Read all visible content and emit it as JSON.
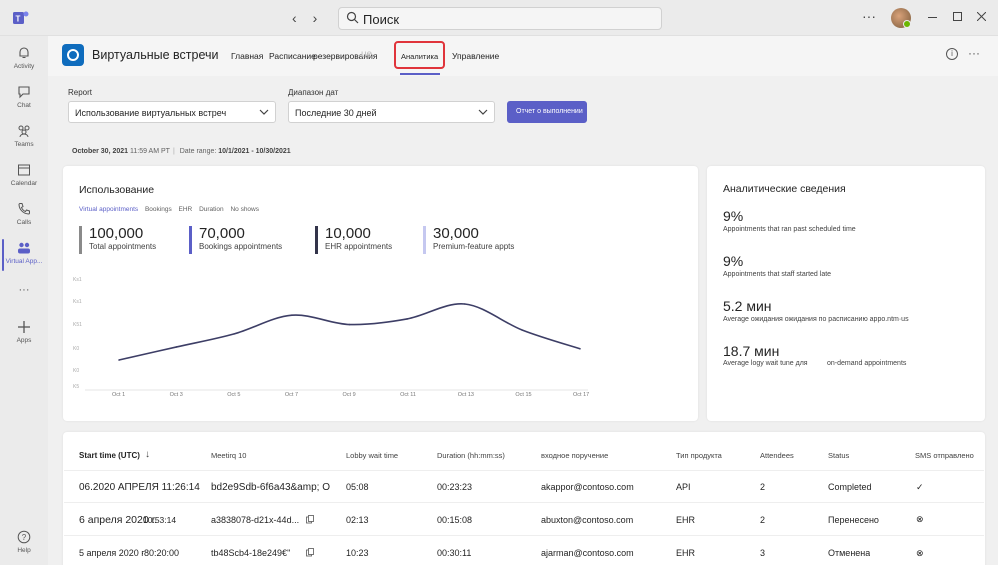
{
  "topbar": {
    "search_placeholder": "Поиск",
    "back": "‹",
    "forward": "›",
    "more": "···"
  },
  "rail": [
    {
      "label": "Activity",
      "icon": "bell-icon"
    },
    {
      "label": "Chat",
      "icon": "chat-icon"
    },
    {
      "label": "Teams",
      "icon": "teams-icon"
    },
    {
      "label": "Calendar",
      "icon": "calendar-icon"
    },
    {
      "label": "Calls",
      "icon": "phone-icon"
    },
    {
      "label": "Virtual App...",
      "icon": "virtual-appointments-icon"
    },
    {
      "label": "···",
      "icon": "more-icon"
    },
    {
      "label": "Apps",
      "icon": "plus-icon"
    },
    {
      "label": "Help",
      "icon": "help-icon"
    }
  ],
  "app": {
    "title": "Виртуальные встречи",
    "tabs": {
      "home": "Главная",
      "schedule": "Расписание",
      "reserved": "резервирования",
      "ghost": "ue",
      "analytics": "Аналитика",
      "manage": "Управление"
    }
  },
  "filters": {
    "report_label": "Report",
    "report_value": "Использование виртуальных встреч",
    "range_label": "Диапазон дат",
    "range_value": "Последние 30 дней",
    "run_button": "Отчет о выполнении"
  },
  "meta": {
    "date": "October 30, 2021",
    "time": "11:59 AM PT",
    "range_label": "Date range:",
    "range": "10/1/2021 - 10/30/2021"
  },
  "usage": {
    "title": "Использование",
    "chips": [
      "Virtual appointments",
      "Bookings",
      "EHR",
      "Duration",
      "No shows"
    ],
    "kpis": [
      {
        "value": "100,000",
        "label": "Total appointments",
        "color": "#8a8a8a"
      },
      {
        "value": "70,000",
        "label": "Bookings appointments",
        "color": "#5b5fc7"
      },
      {
        "value": "10,000",
        "label": "EHR appointments",
        "color": "#33344a"
      },
      {
        "value": "30,000",
        "label": "Premium-feature appts",
        "color": "#c5c8f0"
      }
    ],
    "y_ticks": [
      "Ks1",
      "Ks1",
      "K51",
      "K0",
      "K0",
      "K5"
    ]
  },
  "chart_data": {
    "type": "line",
    "x": [
      "Oct 1",
      "Oct 3",
      "Oct 5",
      "Oct 7",
      "Oct 9",
      "Oct 11",
      "Oct 13",
      "Oct 15",
      "Oct 17"
    ],
    "series": [
      {
        "values": [
          1.5,
          2.2,
          2.9,
          3.9,
          3.4,
          3.7,
          4.5,
          3.1,
          2.1
        ]
      }
    ],
    "ylim": [
      0,
      6
    ],
    "grid": false,
    "line_color": "#3d3e66"
  },
  "insights": {
    "title": "Аналитические сведения",
    "items": [
      {
        "value": "9%",
        "label": "Appointments that ran past scheduled time"
      },
      {
        "value": "9%",
        "label": "Appointments that staff started late"
      },
      {
        "value": "5.2 мин",
        "label": "Average ожидания ожидания по расписанию appo.ntm·us"
      },
      {
        "value": "18.7 мин",
        "label": "Average logy wait tune для",
        "label2": "on-demand appointments"
      }
    ]
  },
  "table": {
    "headers": [
      "Start time (UTC)",
      "Meetirq 10",
      "Lobby wait time",
      "Duration (hh:mm:ss)",
      "входное поручение",
      "Тип продукта",
      "Attendees",
      "Status",
      "SMS отправлено"
    ],
    "sort_arrow": "↓",
    "rows": [
      {
        "start": "06.2020 АПРЕЛЯ 11:26:14",
        "id": "bd2e9Sdb-6f6a43&amp; O",
        "lobby": "05:08",
        "duration": "00:23:23",
        "email": "akappor@contoso.com",
        "product": "API",
        "attendees": "2",
        "status": "Completed",
        "sms": "✓"
      },
      {
        "start": "6 апреля 2020 г.",
        "start_overlay": "10:53:14",
        "id": "a3838078-d21x-44d...",
        "lobby": "02:13",
        "duration": "00:15:08",
        "email": "abuxton@contoso.com",
        "product": "EHR",
        "attendees": "2",
        "status": "Перенесено",
        "sms": "⊗"
      },
      {
        "start": "5 апреля 2020 г",
        "start_overlay": "·80:20:00",
        "id": "tb48Scb4-18e249€\"",
        "lobby": "10:23",
        "duration": "00:30:11",
        "email": "ajarman@contoso.com",
        "product": "EHR",
        "attendees": "3",
        "status": "Отменена",
        "sms": "⊗"
      }
    ]
  }
}
